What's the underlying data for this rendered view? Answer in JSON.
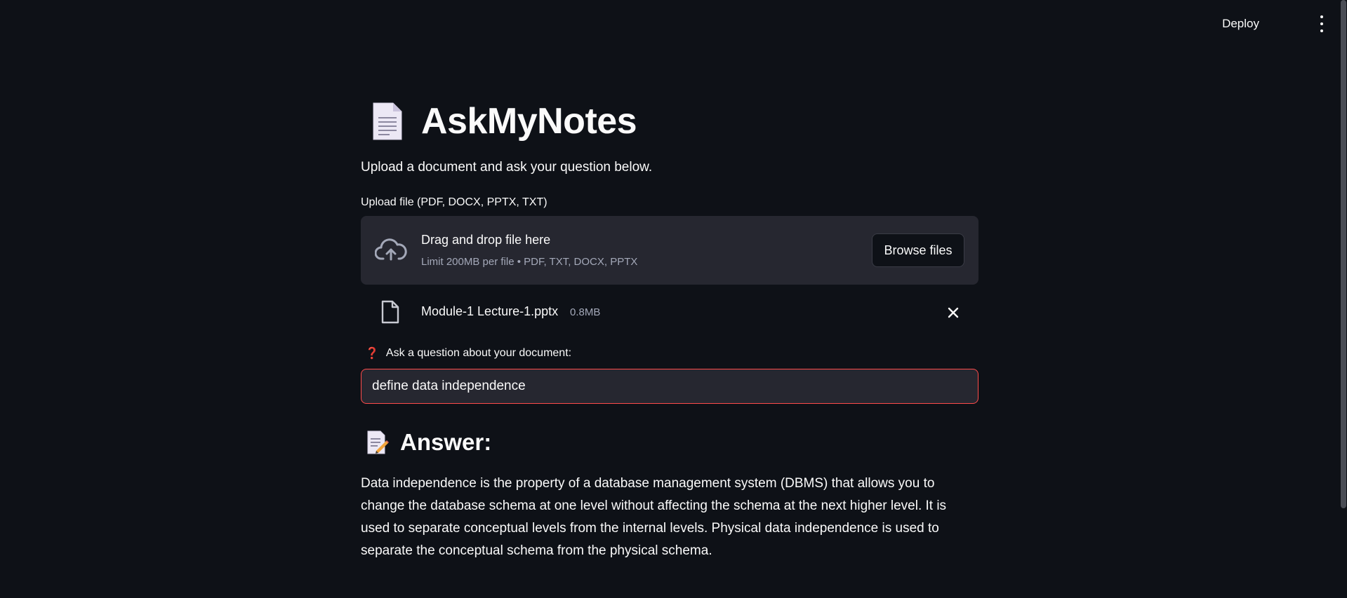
{
  "header": {
    "deploy_label": "Deploy"
  },
  "main": {
    "title": "AskMyNotes",
    "subtitle": "Upload a document and ask your question below.",
    "upload": {
      "label": "Upload file (PDF, DOCX, PPTX, TXT)",
      "dropzone_title": "Drag and drop file here",
      "dropzone_limit": "Limit 200MB per file • PDF, TXT, DOCX, PPTX",
      "browse_label": "Browse files"
    },
    "uploaded_file": {
      "name": "Module-1 Lecture-1.pptx",
      "size": "0.8MB"
    },
    "question": {
      "icon": "❓",
      "label": "Ask a question about your document:",
      "value": "define data independence"
    },
    "answer": {
      "heading": "Answer:",
      "text": "Data independence is the property of a database management system (DBMS) that allows you to change the database schema at one level without affecting the schema at the next higher level. It is used to separate conceptual levels from the internal levels. Physical data independence is used to separate the conceptual schema from the physical schema."
    }
  },
  "icons": {
    "title_icon": "page-facing-up-icon",
    "answer_icon": "memo-icon",
    "upload_icon": "cloud-upload-icon",
    "file_icon": "file-icon",
    "remove_icon": "close-icon",
    "menu_icon": "kebab-menu-icon"
  },
  "colors": {
    "background": "#0e1117",
    "surface": "#262730",
    "accent": "#ff4b4b",
    "text": "#fafafa",
    "muted_text": "#a3a8b8"
  }
}
